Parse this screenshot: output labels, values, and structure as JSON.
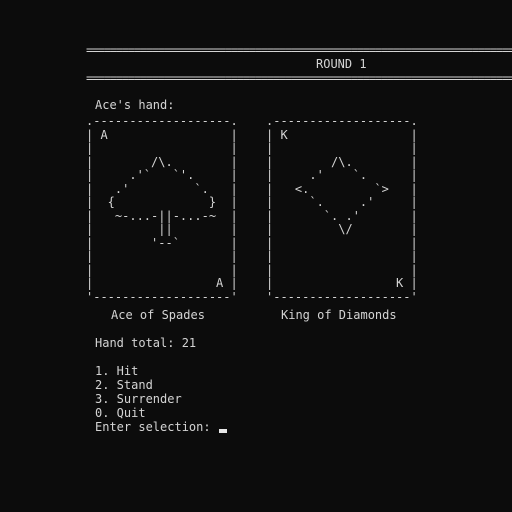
{
  "header": {
    "rule_top": "================================================================================",
    "title": "ROUND 1",
    "rule_bottom": "================================================================================"
  },
  "hand": {
    "label": "Ace's hand:",
    "cards": [
      {
        "art": ".-------------------.\n| A                 |\n|                   |\n|        /\\.        |\n|     .'`   `'.     |\n|   .'         `.   |\n|  {             }  |\n|   ~-...-||-...-~  |\n|         ||        |\n|        '--`       |\n|                   |\n|                   |\n|                 A |\n'-------------------'",
        "caption": "Ace of Spades"
      },
      {
        "art": ".-------------------.\n| K                 |\n|                   |\n|        /\\.        |\n|     .'    `.      |\n|   <.         `>   |\n|     `.     .'     |\n|       `. .'       |\n|         \\/        |\n|                   |\n|                   |\n|                   |\n|                 K |\n'-------------------'",
        "caption": "King of Diamonds"
      }
    ],
    "total_label": "Hand total: 21"
  },
  "menu": {
    "items": [
      {
        "label": "1. Hit"
      },
      {
        "label": "2. Stand"
      },
      {
        "label": "3. Surrender"
      },
      {
        "label": "0. Quit"
      }
    ],
    "prompt": "Enter selection: "
  }
}
